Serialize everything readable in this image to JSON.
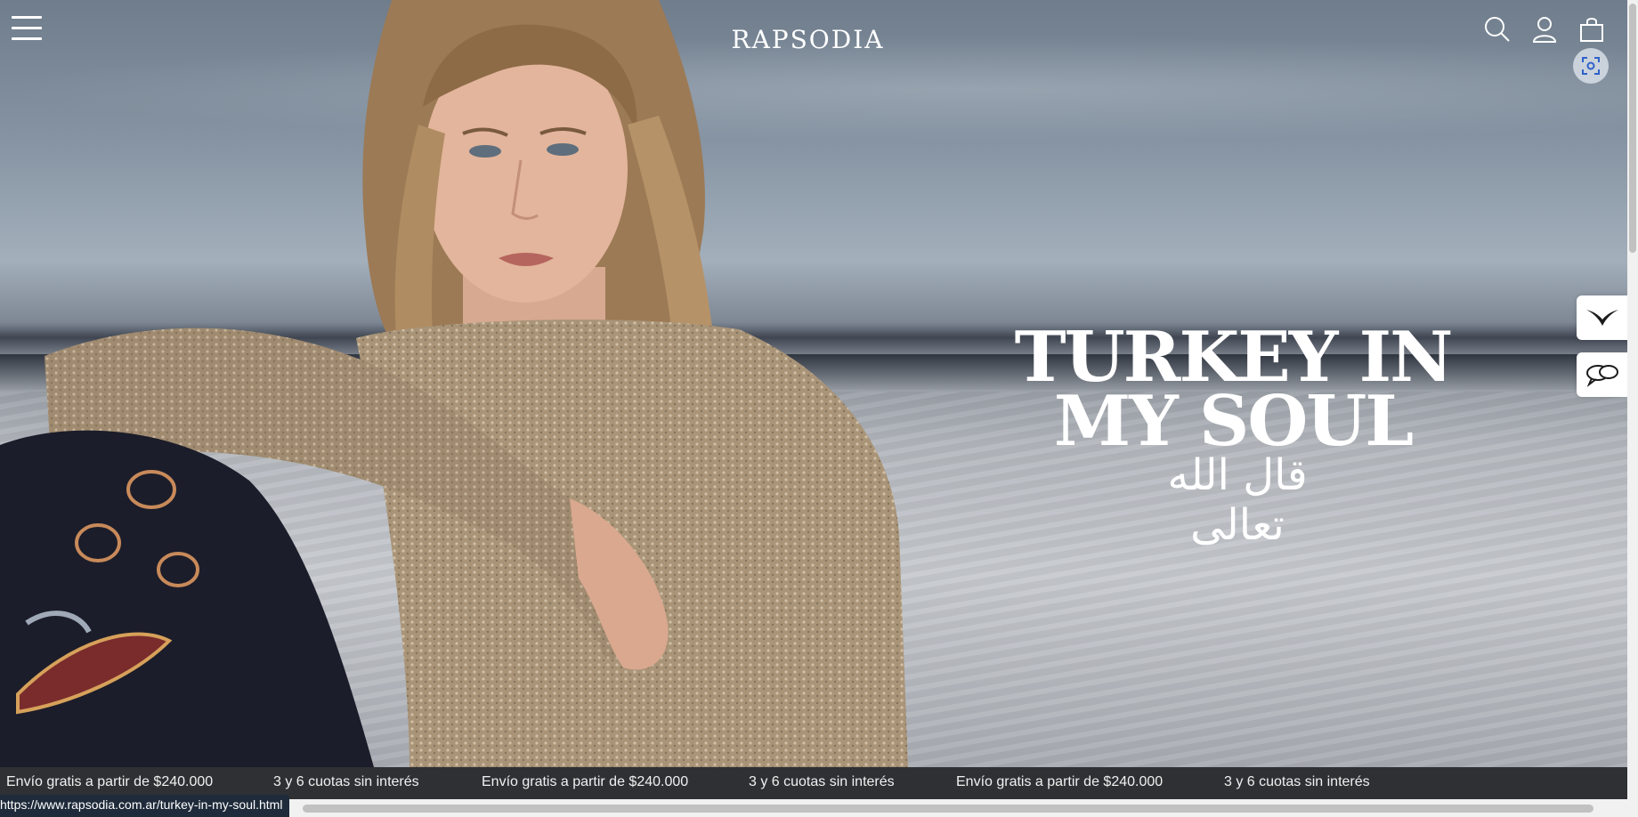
{
  "header": {
    "logo_text": "RAPSODIA",
    "menu_icon": "hamburger-menu-icon",
    "search_icon": "search-icon",
    "account_icon": "user-icon",
    "cart_icon": "shopping-bag-icon",
    "scan_icon": "scan-focus-icon"
  },
  "hero": {
    "headline_line1": "TURKEY IN",
    "headline_line2": "MY SOUL",
    "arabic_text": "قال الله تعالى"
  },
  "side_buttons": [
    {
      "icon": "bird-wings-icon"
    },
    {
      "icon": "chat-bubbles-icon"
    }
  ],
  "ticker": {
    "items": [
      "Envío gratis a partir de $240.000",
      "3 y 6 cuotas sin interés",
      "Envío gratis a partir de $240.000",
      "3 y 6 cuotas sin interés",
      "Envío gratis a partir de $240.000",
      "3 y 6 cuotas sin interés"
    ]
  },
  "status_bar": {
    "url": "https://www.rapsodia.com.ar/turkey-in-my-soul.html"
  },
  "colors": {
    "ticker_bg": "#2f3033",
    "status_bg": "#1f2b3a",
    "text_light": "#ffffff"
  }
}
